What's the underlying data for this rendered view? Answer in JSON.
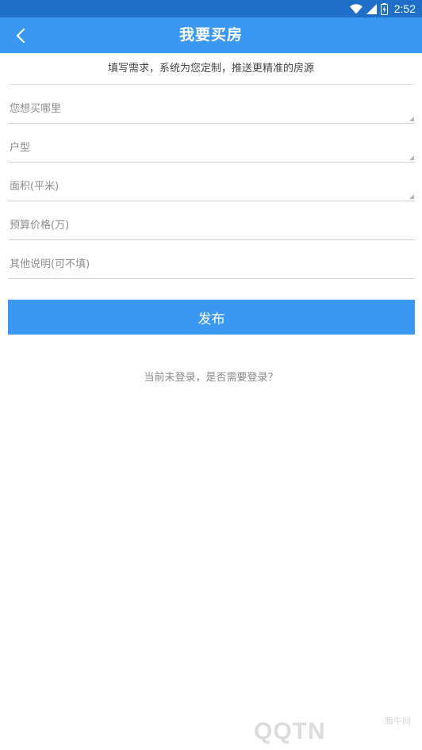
{
  "status_bar": {
    "time": "2:52",
    "icons": [
      "wifi-icon",
      "signal-icon",
      "battery-icon"
    ]
  },
  "app_bar": {
    "title": "我要买房",
    "back_icon": "chevron-left-icon"
  },
  "subtitle": "填写需求，系统为您定制，推送更精准的房源",
  "form": {
    "fields": [
      {
        "label": "您想买哪里",
        "has_dropdown": true
      },
      {
        "label": "户型",
        "has_dropdown": true
      },
      {
        "label": "面积(平米)",
        "has_dropdown": true
      },
      {
        "label": "预算价格(万)",
        "has_dropdown": false
      },
      {
        "label": "其他说明(可不填)",
        "has_dropdown": false
      }
    ],
    "submit_label": "发布"
  },
  "login_prompt": "当前未登录，是否需要登录？",
  "watermark": {
    "logo_text": "QQTN",
    "site_name": "腾牛网"
  },
  "colors": {
    "status_bar": "#1f6fc8",
    "app_bar": "#3a97f2",
    "button": "#3a97f2"
  }
}
